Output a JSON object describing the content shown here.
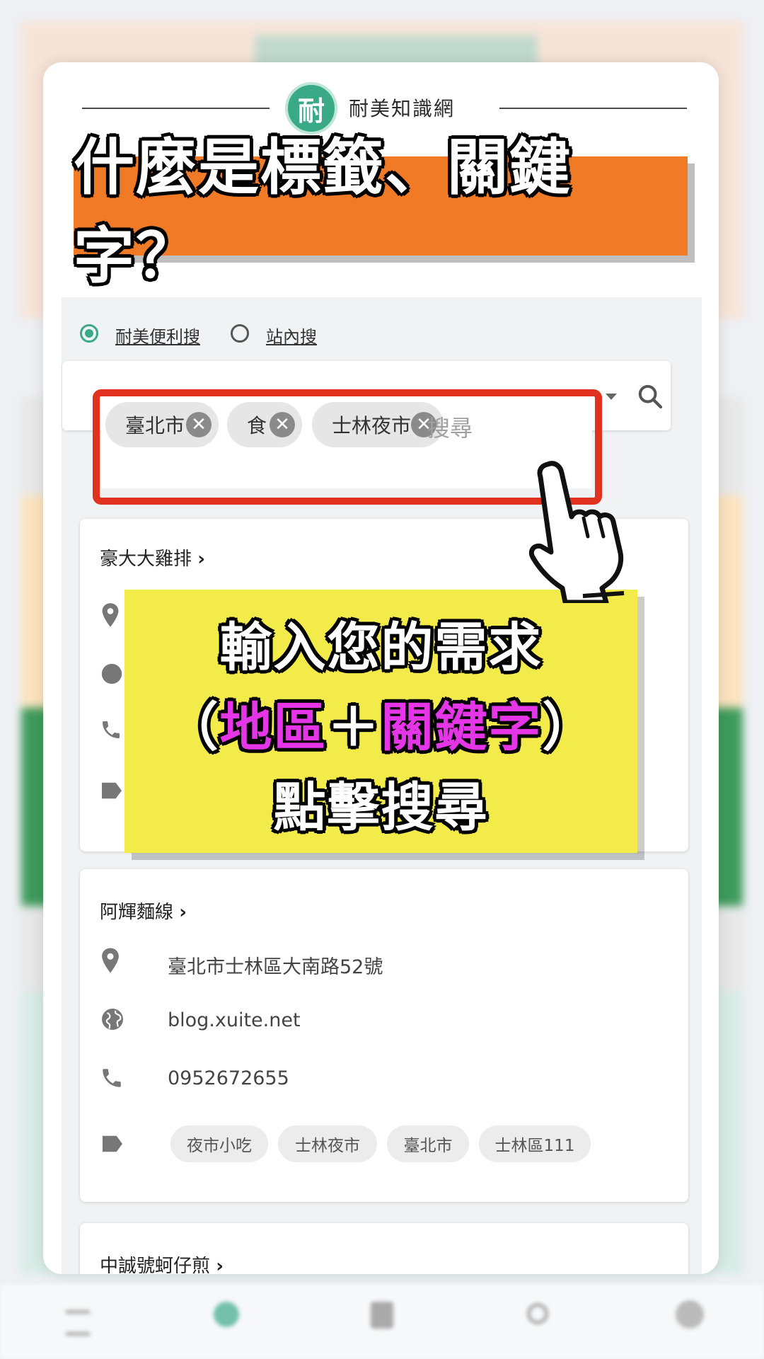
{
  "brand": {
    "logo_char": "耐",
    "name": "耐美知識網"
  },
  "title": "什麼是標籤、關鍵字？",
  "search": {
    "radio_options": [
      {
        "label": "耐美便利搜",
        "selected": true
      },
      {
        "label": "站內搜",
        "selected": false
      }
    ],
    "chips": [
      {
        "label": "臺北市"
      },
      {
        "label": "食"
      },
      {
        "label": "士林夜市"
      }
    ],
    "placeholder": "搜尋",
    "remove_glyph": "✕"
  },
  "callout": {
    "line1": "輸入您的需求",
    "line2_open": "（",
    "line2_region": "地區",
    "line2_plus": "＋",
    "line2_keyword": "關鍵字",
    "line2_close": "）",
    "line3": "點擊搜尋"
  },
  "results": [
    {
      "name": "豪大大雞排",
      "chevron": "›"
    },
    {
      "name": "阿輝麵線",
      "chevron": "›",
      "address": "臺北市士林區大南路52號",
      "website": "blog.xuite.net",
      "phone": "0952672655",
      "tags": [
        "夜市小吃",
        "士林夜市",
        "臺北市",
        "士林區111"
      ]
    },
    {
      "name": "中誠號蚵仔煎",
      "chevron": "›"
    }
  ],
  "colors": {
    "accent_green": "#3aaa86",
    "banner_orange": "#f07a26",
    "highlight_red": "#e0321e",
    "callout_yellow": "#f3eb4a",
    "keyword_magenta": "#e436e6"
  }
}
